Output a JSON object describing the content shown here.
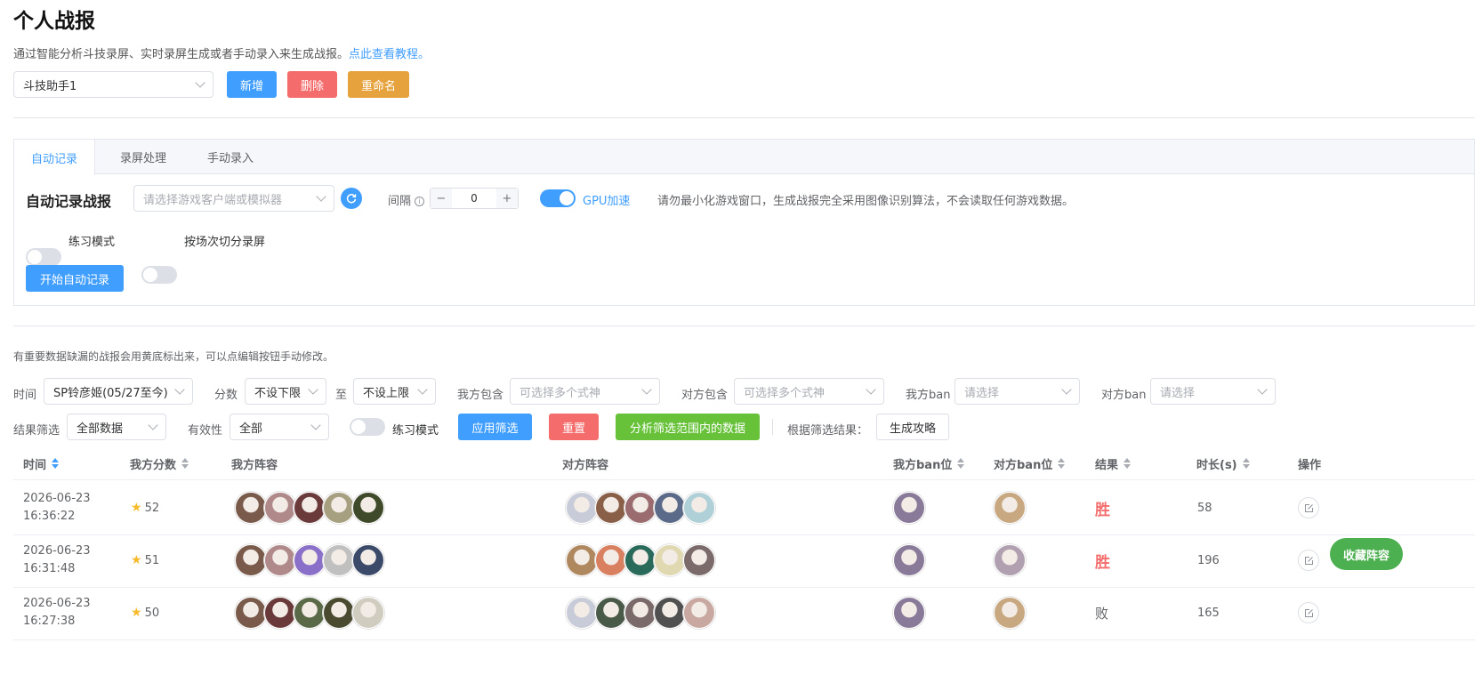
{
  "page": {
    "title": "个人战报",
    "subtitle": "通过智能分析斗技录屏、实时录屏生成或者手动录入来生成战报。",
    "subtitle_link": "点此查看教程。"
  },
  "profile": {
    "selected": "斗技助手1",
    "add_label": "新增",
    "delete_label": "删除",
    "rename_label": "重命名"
  },
  "tabs": [
    {
      "label": "自动记录",
      "active": true
    },
    {
      "label": "录屏处理",
      "active": false
    },
    {
      "label": "手动录入",
      "active": false
    }
  ],
  "auto": {
    "title": "自动记录战报",
    "client_placeholder": "请选择游戏客户端或模拟器",
    "interval_label": "间隔",
    "interval_value": "0",
    "gpu_label": "GPU加速",
    "gpu_on": true,
    "notice": "请勿最小化游戏窗口，生成战报完全采用图像识别算法，不会读取任何游戏数据。",
    "practice_label": "练习模式",
    "split_label": "按场次切分录屏",
    "start_label": "开始自动记录"
  },
  "filters": {
    "hint": "有重要数据缺漏的战报会用黄底标出来，可以点编辑按钮手动修改。",
    "time_label": "时间",
    "time_value": "SP铃彦姬(05/27至今)",
    "score_label": "分数",
    "score_min": "不设下限",
    "to_label": "至",
    "score_max": "不设上限",
    "my_include_label": "我方包含",
    "my_include_placeholder": "可选择多个式神",
    "op_include_label": "对方包含",
    "op_include_placeholder": "可选择多个式神",
    "my_ban_label": "我方ban",
    "my_ban_placeholder": "请选择",
    "op_ban_label": "对方ban",
    "op_ban_placeholder": "请选择",
    "result_label": "结果筛选",
    "result_value": "全部数据",
    "validity_label": "有效性",
    "validity_value": "全部",
    "practice_label": "练习模式",
    "apply_label": "应用筛选",
    "reset_label": "重置",
    "analyze_label": "分析筛选范围内的数据",
    "gen_prefix": "根据筛选结果：",
    "gen_label": "生成攻略"
  },
  "table": {
    "columns": [
      "时间",
      "我方分数",
      "我方阵容",
      "对方阵容",
      "我方ban位",
      "对方ban位",
      "结果",
      "时长(s)",
      "操作"
    ],
    "rows": [
      {
        "date": "2026-06-23",
        "time": "16:36:22",
        "score": "52",
        "result": "胜",
        "win": true,
        "duration": "58",
        "my": [
          "#7a5a4a",
          "#b08a8a",
          "#6b3a3a",
          "#a7a080",
          "#3e4a2a"
        ],
        "op": [
          "#c8cbd8",
          "#8a5f48",
          "#9a6c70",
          "#5a6a88",
          "#b0d0d8"
        ],
        "myban": "#8a7a9a",
        "opban": "#c8a880"
      },
      {
        "date": "2026-06-23",
        "time": "16:31:48",
        "score": "51",
        "result": "胜",
        "win": true,
        "duration": "196",
        "my": [
          "#7a5a4a",
          "#b08a8a",
          "#8a70c8",
          "#c0c0c0",
          "#3a4a68"
        ],
        "op": [
          "#b08860",
          "#d88060",
          "#2a6a5a",
          "#e0d8b0",
          "#7a6a6a"
        ],
        "myban": "#8a7a9a",
        "opban": "#b0a0b0"
      },
      {
        "date": "2026-06-23",
        "time": "16:27:38",
        "score": "50",
        "result": "败",
        "win": false,
        "duration": "165",
        "my": [
          "#7a5a4a",
          "#6a3a3a",
          "#5a6a48",
          "#4a4a30",
          "#d0ccc0"
        ],
        "op": [
          "#c8cbd8",
          "#4a5a48",
          "#7a6a6a",
          "#505050",
          "#c8a8a0"
        ],
        "myban": "#8a7a9a",
        "opban": "#c8a880"
      }
    ]
  },
  "fab_label": "收藏阵容",
  "colors": {
    "primary": "#409eff",
    "danger": "#f56c6c",
    "warning": "#e6a23c",
    "success": "#67c23a",
    "fab": "#4caf50"
  }
}
